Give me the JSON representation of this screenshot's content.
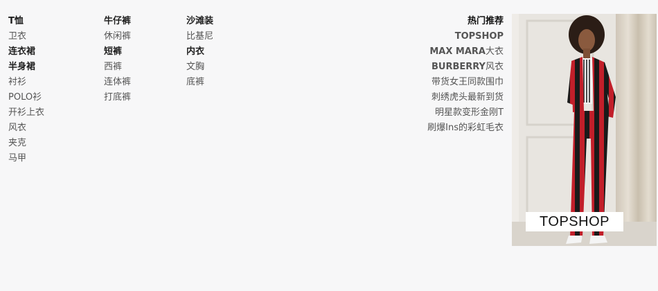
{
  "columns": {
    "tops": [
      {
        "label": "T恤",
        "bold": true
      },
      {
        "label": "卫衣",
        "bold": false
      },
      {
        "label": "连衣裙",
        "bold": true
      },
      {
        "label": "半身裙",
        "bold": true
      },
      {
        "label": "衬衫",
        "bold": false
      },
      {
        "label": "POLO衫",
        "bold": false
      },
      {
        "label": "开衫上衣",
        "bold": false
      },
      {
        "label": "风衣",
        "bold": false
      },
      {
        "label": "夹克",
        "bold": false
      },
      {
        "label": "马甲",
        "bold": false
      }
    ],
    "bottoms": [
      {
        "label": "牛仔裤",
        "bold": true
      },
      {
        "label": "休闲裤",
        "bold": false
      },
      {
        "label": "短裤",
        "bold": true
      },
      {
        "label": "西裤",
        "bold": false
      },
      {
        "label": "连体裤",
        "bold": false
      },
      {
        "label": "打底裤",
        "bold": false
      }
    ],
    "others": [
      {
        "label": "沙滩装",
        "bold": true
      },
      {
        "label": "比基尼",
        "bold": false
      },
      {
        "label": "内衣",
        "bold": true
      },
      {
        "label": "文胸",
        "bold": false
      },
      {
        "label": "底裤",
        "bold": false
      }
    ]
  },
  "recommend": {
    "heading": "热门推荐",
    "items": [
      {
        "label": "TOPSHOP"
      },
      {
        "brand": "MAX MARA",
        "rest": "大衣"
      },
      {
        "brand": "BURBERRY",
        "rest": "风衣"
      },
      {
        "label": "带货女王同款围巾"
      },
      {
        "label": "刺绣虎头最新到货"
      },
      {
        "label": "明星款变形金刚T"
      },
      {
        "label": "刷爆Ins的彩虹毛衣"
      }
    ]
  },
  "promo": {
    "badge": "TOPSHOP",
    "colors": {
      "suit_red": "#c21f2a",
      "suit_black": "#1a1a1a",
      "wall": "#e8e5e0",
      "curtain": "#d9d2c6"
    }
  }
}
